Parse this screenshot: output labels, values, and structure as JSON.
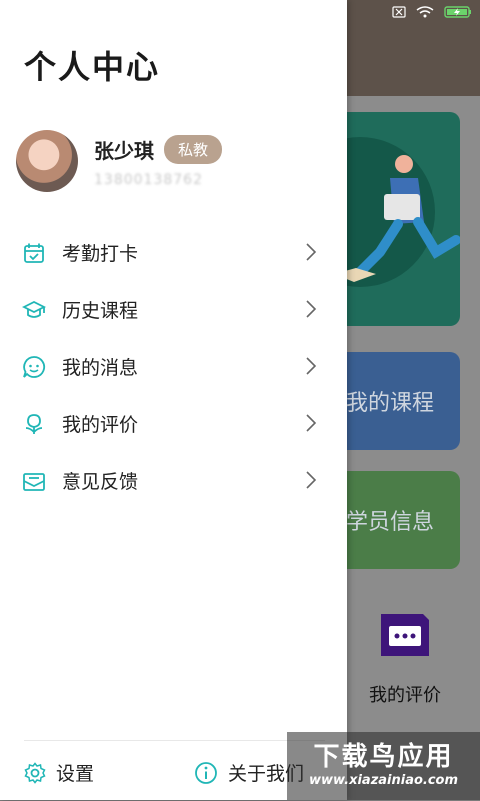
{
  "background": {
    "card_course": "我的课程",
    "card_student": "学员信息",
    "eval_label": "我的评价"
  },
  "drawer": {
    "title": "个人中心",
    "profile": {
      "name": "张少琪",
      "role_badge": "私教",
      "phone": "13800138762"
    },
    "menu": [
      {
        "label": "考勤打卡",
        "icon": "calendar-check-icon"
      },
      {
        "label": "历史课程",
        "icon": "graduation-cap-icon"
      },
      {
        "label": "我的消息",
        "icon": "chat-bubble-icon"
      },
      {
        "label": "我的评价",
        "icon": "flower-icon"
      },
      {
        "label": "意见反馈",
        "icon": "envelope-icon"
      }
    ],
    "footer": {
      "settings_label": "设置",
      "about_label": "关于我们"
    }
  },
  "watermark": {
    "top": "下载鸟应用",
    "bottom": "www.xiazainiao.com"
  },
  "colors": {
    "accent": "#20b6b6",
    "badge": "#b9a28f"
  }
}
